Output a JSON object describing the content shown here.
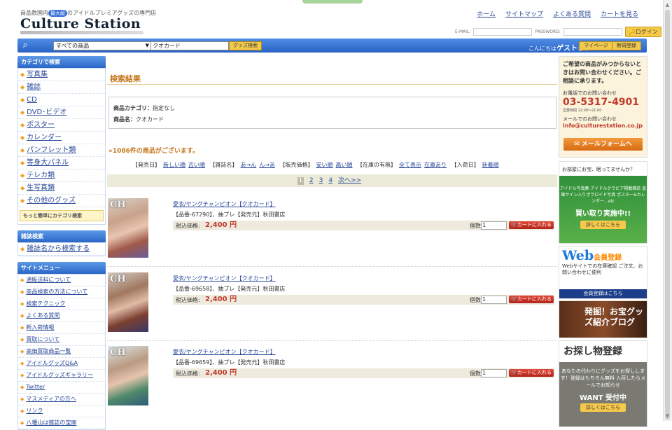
{
  "header": {
    "tagline_pre": "商品数国内",
    "tagline_badge": "最大級",
    "tagline_post": "のアイドルプレミアグッズの専門店",
    "logo": "Culture Station",
    "links": [
      "ホーム",
      "サイトマップ",
      "よくある質問",
      "カートを見る"
    ],
    "email_label": "E-MAIL:",
    "password_label": "PASSWORD:",
    "login_button": "ログイン"
  },
  "search": {
    "category_value": "すべての商品",
    "keyword_value": "クオカード",
    "search_button": "グッズ検索",
    "greeting_pre": "こんにちは",
    "greeting_name": "ゲスト",
    "greeting_post": "さん",
    "mypage_button": "マイページ",
    "register_button": "新規登録"
  },
  "left": {
    "category_header": "カテゴリで検索",
    "categories": [
      "写真集",
      "雑誌",
      "CD",
      "DVD･ビデオ",
      "ポスター",
      "カレンダー",
      "パンフレット類",
      "等身大パネル",
      "テレカ類",
      "生写真類",
      "その他のグッズ"
    ],
    "category_more": "もっと簡単にカテゴリ検索",
    "magazine_header": "雑誌検索",
    "magazine_link": "雑誌名から検索する",
    "site_header": "サイトメニュー",
    "site_menu": [
      "通販送料について",
      "商品検索の方法について",
      "検索テクニック",
      "よくある質問",
      "新入荷情報",
      "買取について",
      "高価買取商品一覧",
      "アイドルグッズQ&A",
      "アイドルグッズギャラリー",
      "Twitter",
      "マスメディアの方へ",
      "リンク",
      "八幡山は雑誌の宝庫"
    ]
  },
  "main": {
    "title": "検索結果",
    "cond_category_label": "商品カテゴリ：",
    "cond_category_value": "指定なし",
    "cond_name_label": "商品名：",
    "cond_name_value": "クオカード",
    "count": "1086件の商品がございます。",
    "sort": [
      {
        "group": "【発売日】",
        "options": [
          "新しい順",
          "古い順"
        ]
      },
      {
        "group": "【雑誌名】",
        "options": [
          "あ→ん",
          "ん→あ"
        ]
      },
      {
        "group": "【販売価格】",
        "options": [
          "安い順",
          "高い順"
        ]
      },
      {
        "group": "【在庫の有無】",
        "options": [
          "全て表示",
          "在庫あり"
        ]
      },
      {
        "group": "【入荷日】",
        "options": [
          "新着順"
        ]
      }
    ],
    "pager": {
      "current": "1",
      "pages": [
        "2",
        "3",
        "4"
      ],
      "next": "次へ>>"
    },
    "items": [
      {
        "title": "愛衣/ヤングチャンピオン【クオカード】",
        "meta": "【品番-67290】、抽プレ【発売元】秋田書店",
        "price_label": "税込価格:",
        "price": "2,400 円",
        "qty_label": "個数",
        "qty": "1",
        "cart": "カートに入れる",
        "cover": "CH"
      },
      {
        "title": "愛衣/ヤングチャンピオン【クオカード】",
        "meta": "【品番-69658】、抽プレ【発売元】秋田書店",
        "price_label": "税込価格:",
        "price": "2,400 円",
        "qty_label": "個数",
        "qty": "1",
        "cart": "カートに入れる",
        "cover": "CH"
      },
      {
        "title": "愛衣/ヤングチャンピオン【クオカード】",
        "meta": "【品番-69659】、抽プレ【発売元】秋田書店",
        "price_label": "税込価格:",
        "price": "2,400 円",
        "qty_label": "個数",
        "qty": "1",
        "cart": "カートに入れる",
        "cover": "CH"
      }
    ]
  },
  "right": {
    "help_text": "ご希望の商品がみつからないときはお問い合わせください。ご相談に承ります。",
    "tel_label": "お電話でのお問い合わせ",
    "tel": "03-5317-4901",
    "hours": "営業時間 12:00～21:00",
    "mail_label": "メールでのお問い合わせ",
    "mail": "info@culturestation.co.jp",
    "mailform_button": "メールフォームへ",
    "buy_question": "お部屋にお宝、眠ってませんか？",
    "buy_sub": "アイドル写真集 アイドルグラビア掲載雑誌 直筆サイン入りポラロイド写真 ポスター&カレンダー…etc",
    "buy_big": "買い取り実施中!!",
    "buy_more": "詳しくはこちら",
    "web_title": "Web",
    "web_title2": "会員登録",
    "web_desc": "Webサイトでの在庫確認 ご注文、お問い合わせに便利",
    "web_bar": "会員登録はこちら",
    "blog_title": "発掘！お宝グッズ紹介ブログ",
    "want_title": "お探し物登録",
    "want_desc": "あなたの代わりにグッズをお探しします！登録はもちろん無料 入荷したらメールでお知らせ",
    "want_big": "WANT 受付中",
    "want_more": "詳しくはこちら"
  }
}
